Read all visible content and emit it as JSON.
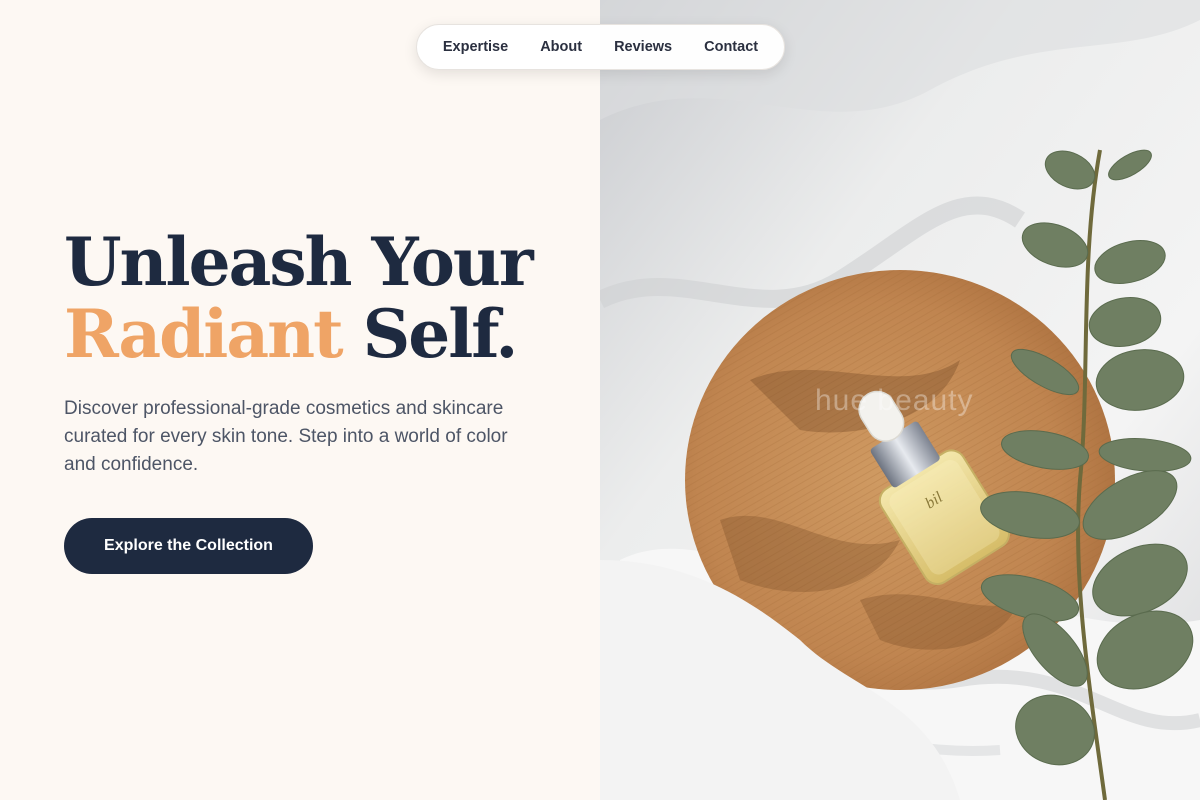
{
  "nav": {
    "items": [
      {
        "label": "Expertise"
      },
      {
        "label": "About"
      },
      {
        "label": "Reviews"
      },
      {
        "label": "Contact"
      }
    ]
  },
  "hero": {
    "title_line1": "Unleash Your",
    "title_accent": "Radiant",
    "title_rest": " Self.",
    "description": "Discover professional-grade cosmetics and skincare curated for every skin tone. Step into a world of color and confidence.",
    "cta_label": "Explore the Collection"
  },
  "photo": {
    "watermark": "hue beauty",
    "bottle_label": "bil"
  },
  "colors": {
    "background": "#fdf8f3",
    "navy": "#1e2a40",
    "accent": "#efa466",
    "body_text": "#4d5566"
  }
}
